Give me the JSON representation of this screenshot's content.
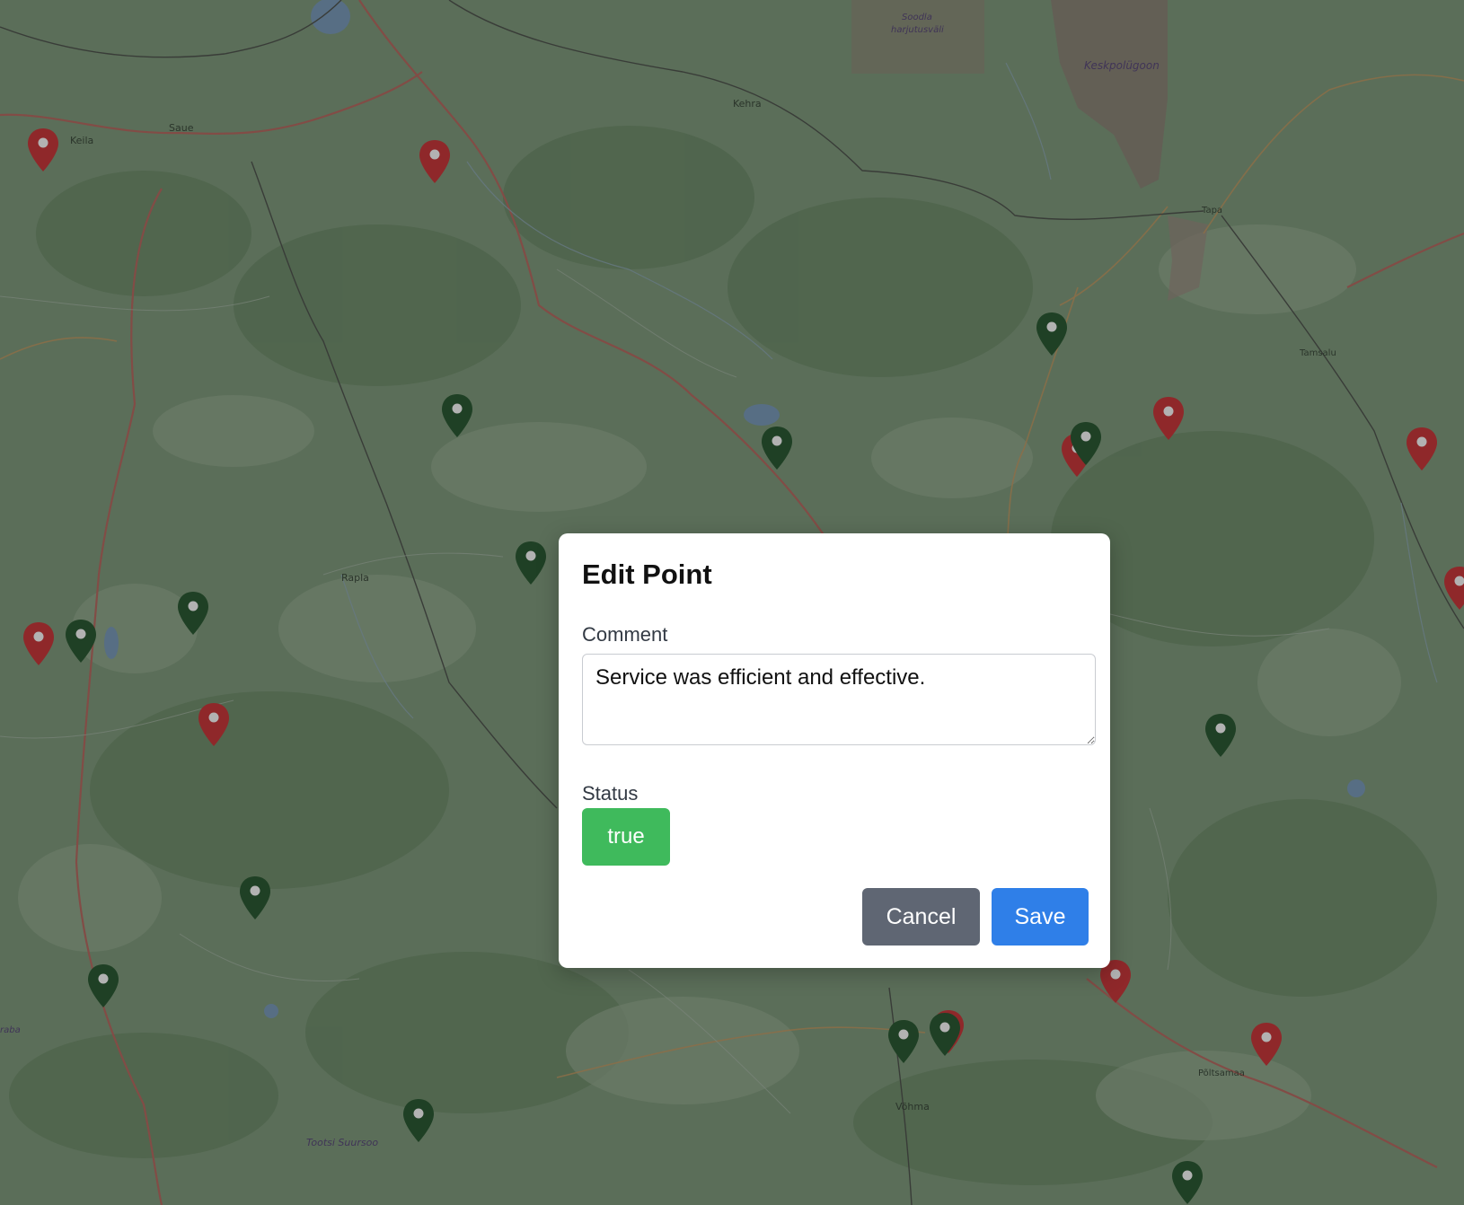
{
  "map": {
    "labels": {
      "keila": "Keila",
      "saue": "Saue",
      "kehra": "Kehra",
      "soodla": "Soodla",
      "harjutusvali": "harjutusväli",
      "keskpolugoon": "Keskpolügoon",
      "tapa": "Tapa",
      "tamsalu": "Tamsalu",
      "rapla": "Rapla",
      "vohma": "Võhma",
      "poltsamaa": "Põltsamaa",
      "tootsi": "Tootsi Suursoo",
      "raba": "raba"
    },
    "pin_colors": {
      "red": "#b8292b",
      "green": "#1d4a24"
    },
    "pin_icon": "map-marker-icon"
  },
  "modal": {
    "title": "Edit Point",
    "comment_label": "Comment",
    "comment_value": "Service was efficient and effective.",
    "status_label": "Status",
    "status_value": "true",
    "cancel_label": "Cancel",
    "save_label": "Save"
  },
  "colors": {
    "status_true": "#3fba5c",
    "cancel": "#5f6673",
    "save": "#2f7fe8"
  }
}
